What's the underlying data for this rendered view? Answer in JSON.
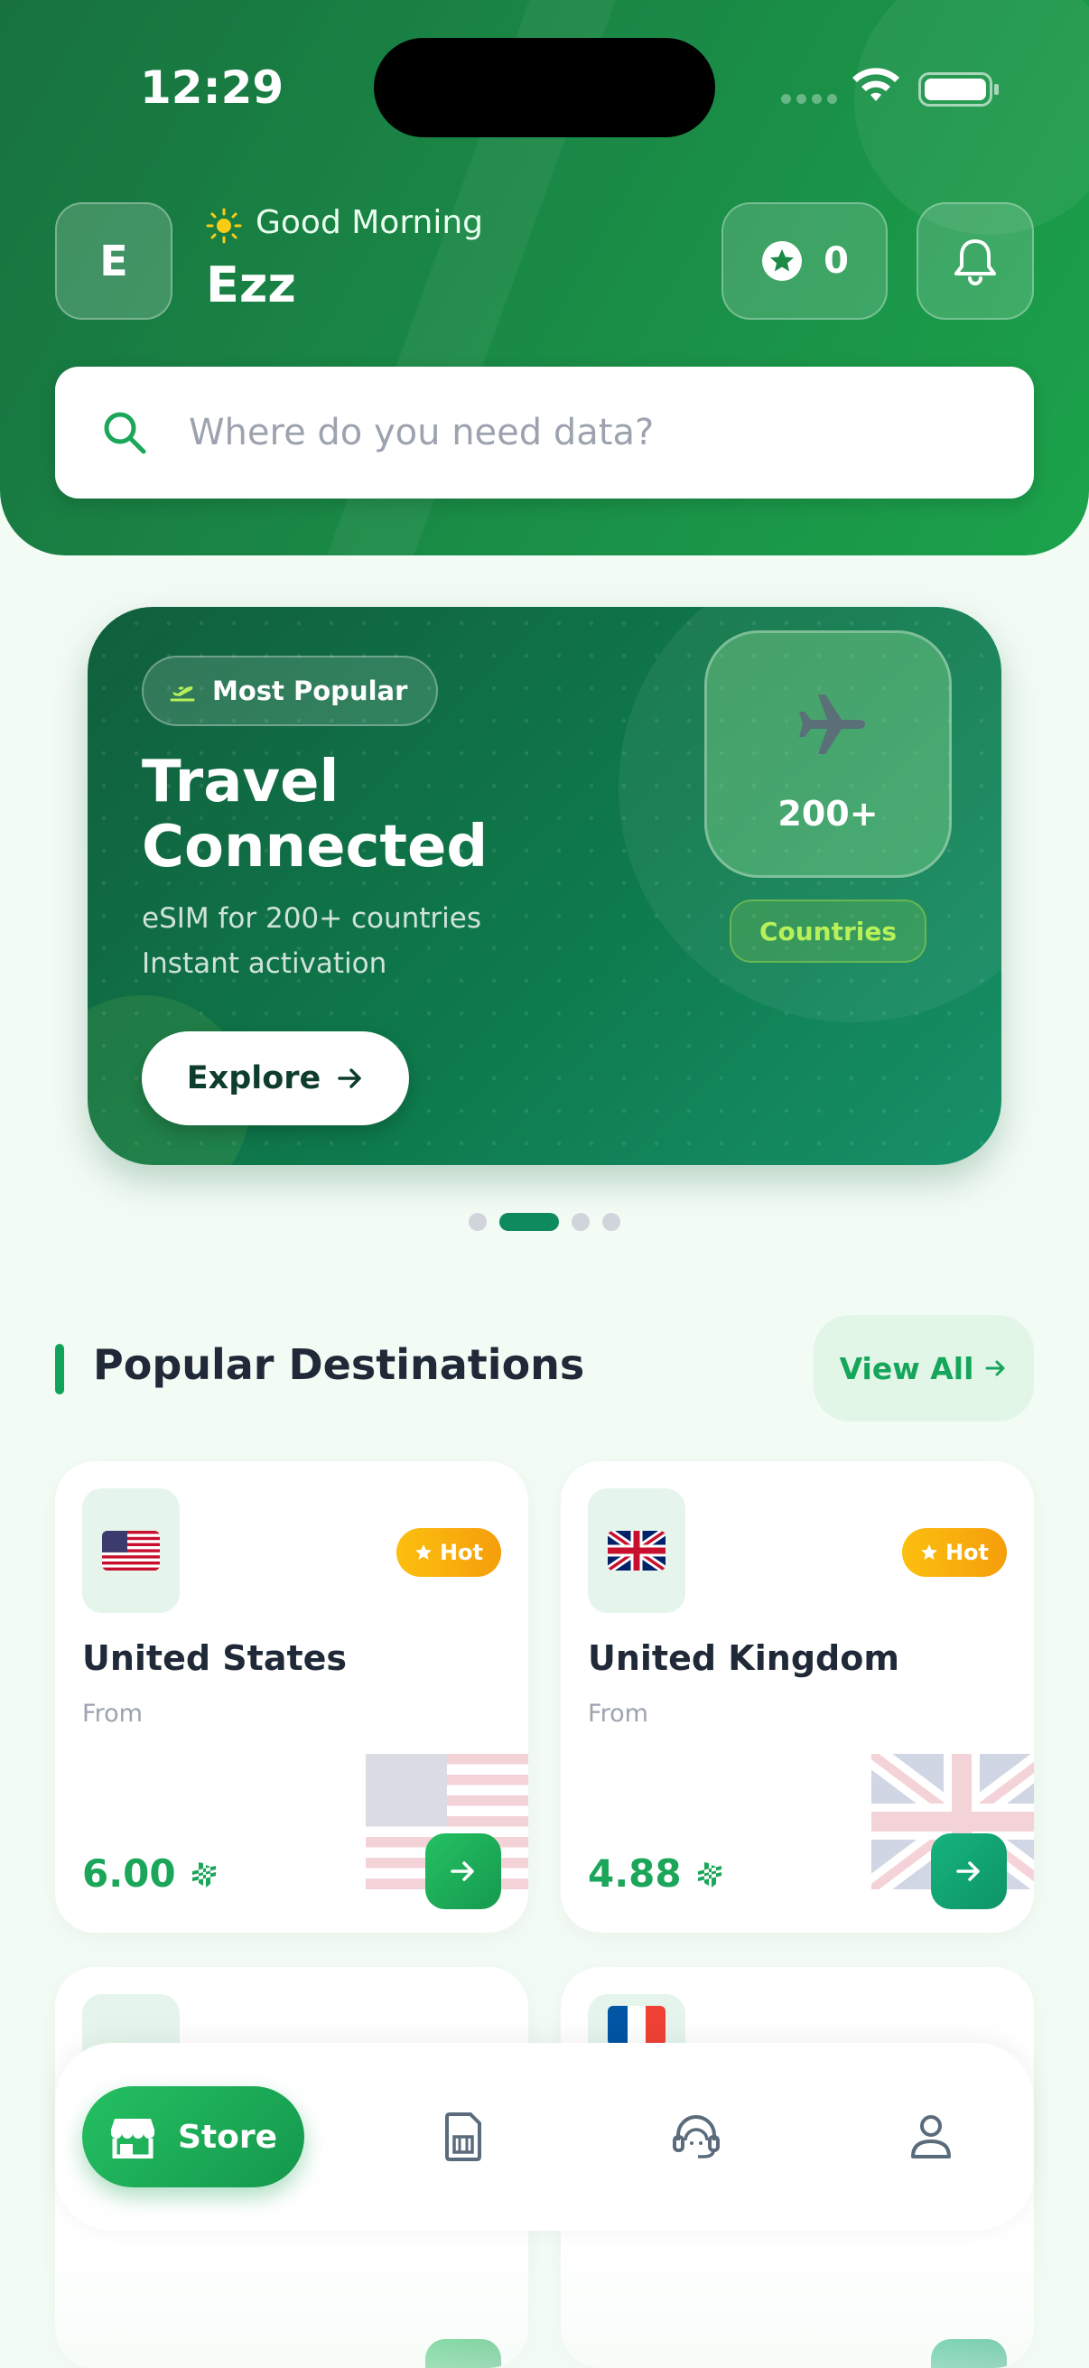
{
  "status_bar": {
    "time": "12:29"
  },
  "header": {
    "avatar_initial": "E",
    "greeting": "Good Morning",
    "username": "Ezz",
    "points": "0"
  },
  "search": {
    "placeholder": "Where do you need data?"
  },
  "banner": {
    "badge": "Most Popular",
    "title": "Travel Connected",
    "subtitle_line1": "eSIM for 200+ countries",
    "subtitle_line2": "Instant activation",
    "cta": "Explore",
    "count": "200+",
    "count_label": "Countries",
    "pages": 4,
    "active_page": 2
  },
  "section": {
    "title": "Popular Destinations",
    "view_all": "View All"
  },
  "destinations": [
    {
      "name": "United States",
      "from_label": "From",
      "price": "6.00",
      "currency": "⃁",
      "badge": "Hot",
      "flag": "us-flag"
    },
    {
      "name": "United Kingdom",
      "from_label": "From",
      "price": "4.88",
      "currency": "⃁",
      "badge": "Hot",
      "flag": "uk-flag"
    }
  ],
  "bottom_nav": {
    "active_label": "Store",
    "items": [
      "store-icon",
      "sim-card-icon",
      "support-headset-icon",
      "profile-icon"
    ]
  },
  "colors": {
    "header_green": "#1a8a46",
    "banner_green": "#0e7a4c",
    "accent_green": "#1ba65a",
    "hot_badge": "#fcbf0f"
  }
}
